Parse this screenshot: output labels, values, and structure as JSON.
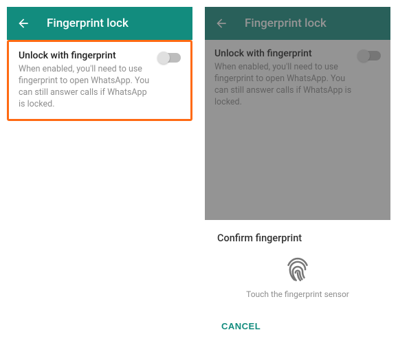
{
  "left": {
    "header": {
      "title": "Fingerprint lock"
    },
    "setting": {
      "title": "Unlock with fingerprint",
      "desc": "When enabled, you'll need to use fingerprint to open WhatsApp. You can still answer calls if WhatsApp is locked."
    }
  },
  "right": {
    "header": {
      "title": "Fingerprint lock"
    },
    "setting": {
      "title": "Unlock with fingerprint",
      "desc": "When enabled, you'll need to use fingerprint to open WhatsApp. You can still answer calls if WhatsApp is locked."
    },
    "dialog": {
      "title": "Confirm fingerprint",
      "hint": "Touch the fingerprint sensor",
      "cancel": "CANCEL"
    }
  },
  "colors": {
    "brand": "#128C7E",
    "highlight": "#FF6A13"
  }
}
